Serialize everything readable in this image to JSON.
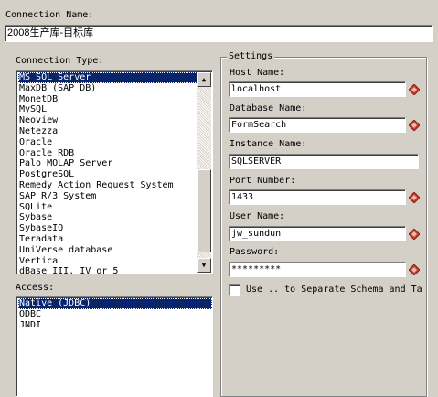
{
  "connection_name": {
    "label": "Connection Name:",
    "value": "2008生产库-目标库"
  },
  "connection_type": {
    "label": "Connection Type:",
    "items": [
      "MS SQL Server",
      "MaxDB (SAP DB)",
      "MonetDB",
      "MySQL",
      "Neoview",
      "Netezza",
      "Oracle",
      "Oracle RDB",
      "Palo MOLAP Server",
      "PostgreSQL",
      "Remedy Action Request System",
      "SAP R/3 System",
      "SQLite",
      "Sybase",
      "SybaseIQ",
      "Teradata",
      "UniVerse database",
      "Vertica",
      "dBase III, IV or 5"
    ],
    "selected": "MS SQL Server"
  },
  "access": {
    "label": "Access:",
    "items": [
      "Native (JDBC)",
      "ODBC",
      "JNDI"
    ],
    "selected": "Native (JDBC)"
  },
  "settings": {
    "title": "Settings",
    "host_name": {
      "label": "Host Name:",
      "value": "localhost"
    },
    "database_name": {
      "label": "Database Name:",
      "value": "FormSearch"
    },
    "instance_name": {
      "label": "Instance Name:",
      "value": "SQLSERVER"
    },
    "port_number": {
      "label": "Port Number:",
      "value": "1433"
    },
    "user_name": {
      "label": "User Name:",
      "value": "jw_sundun"
    },
    "password": {
      "label": "Password:",
      "value": "*********"
    },
    "separator_checkbox": {
      "label": "Use .. to Separate Schema and Ta",
      "checked": false
    }
  },
  "icons": {
    "variable": "diamond-variable-icon",
    "scroll_up": "arrow-up-icon",
    "scroll_down": "arrow-down-icon"
  },
  "colors": {
    "background": "#d4d0c8",
    "selection": "#0a246a",
    "variable_icon": "#c0392b"
  }
}
